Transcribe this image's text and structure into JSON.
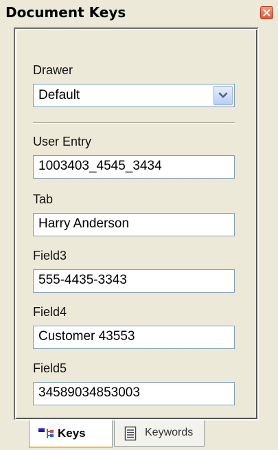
{
  "panel": {
    "title": "Document Keys"
  },
  "form": {
    "drawer": {
      "label": "Drawer",
      "value": "Default"
    },
    "fields": [
      {
        "label": "User Entry",
        "value": "1003403_4545_3434"
      },
      {
        "label": "Tab",
        "value": "Harry Anderson"
      },
      {
        "label": "Field3",
        "value": "555-4435-3343"
      },
      {
        "label": "Field4",
        "value": "Customer 43553"
      },
      {
        "label": "Field5",
        "value": "34589034853003"
      }
    ]
  },
  "tabs": [
    {
      "label": "Keys",
      "icon": "keys-icon",
      "selected": true
    },
    {
      "label": "Keywords",
      "icon": "keywords-list-icon",
      "selected": false
    }
  ],
  "colors": {
    "window_bg": "#ece9d8",
    "close_button": "#e2583a",
    "input_border": "#7f9db9",
    "active_tab_accent": "#f9b742"
  }
}
